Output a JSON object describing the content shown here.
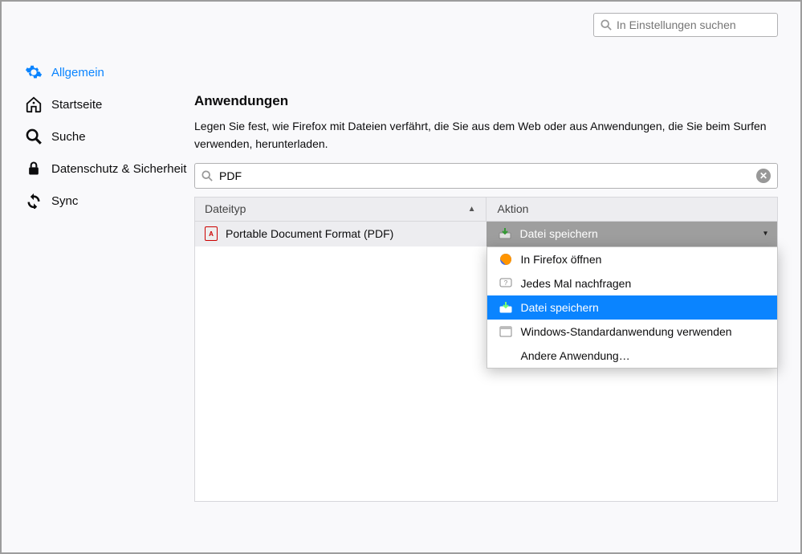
{
  "header": {
    "search_placeholder": "In Einstellungen suchen"
  },
  "sidebar": {
    "items": [
      {
        "label": "Allgemein",
        "icon": "gear"
      },
      {
        "label": "Startseite",
        "icon": "home"
      },
      {
        "label": "Suche",
        "icon": "search"
      },
      {
        "label": "Datenschutz & Sicherheit",
        "icon": "lock"
      },
      {
        "label": "Sync",
        "icon": "sync"
      }
    ]
  },
  "main": {
    "section_title": "Anwendungen",
    "section_desc": "Legen Sie fest, wie Firefox mit Dateien verfährt, die Sie aus dem Web oder aus Anwendungen, die Sie beim Surfen verwenden, herunterladen.",
    "filter_value": "PDF",
    "columns": {
      "type": "Dateityp",
      "action": "Aktion"
    },
    "rows": [
      {
        "type": "Portable Document Format (PDF)",
        "action": "Datei speichern"
      }
    ],
    "dropdown": [
      {
        "label": "In Firefox öffnen",
        "icon": "firefox"
      },
      {
        "label": "Jedes Mal nachfragen",
        "icon": "ask"
      },
      {
        "label": "Datei speichern",
        "icon": "save"
      },
      {
        "label": "Windows-Standardanwendung verwenden",
        "icon": "windows"
      },
      {
        "label": "Andere Anwendung…",
        "icon": "none"
      }
    ]
  }
}
